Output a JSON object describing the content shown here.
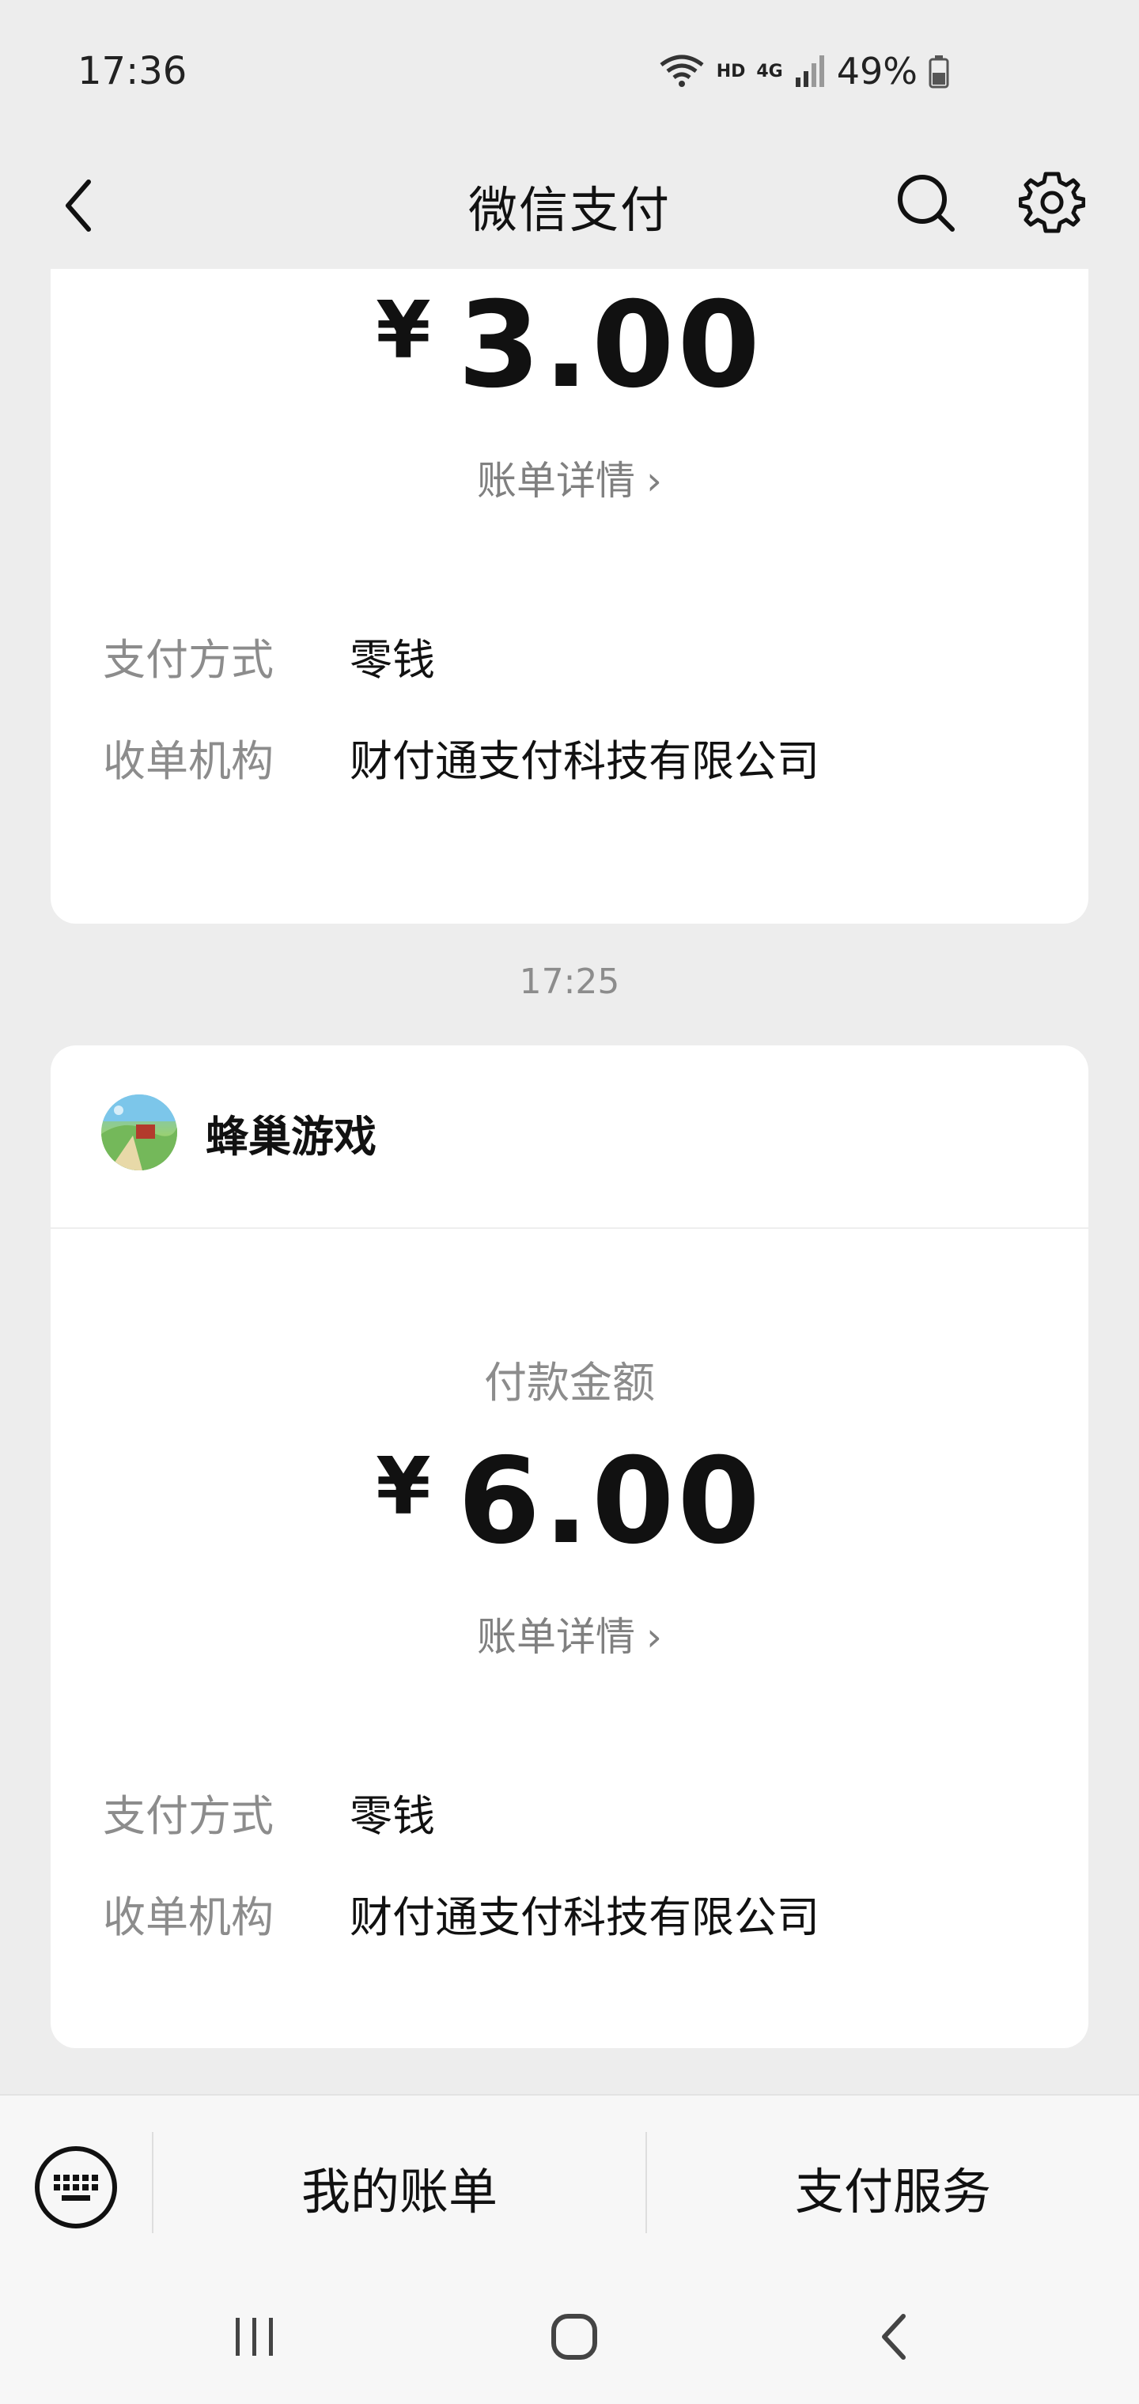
{
  "status_bar": {
    "time": "17:36",
    "network_hd": "HD",
    "network_4g": "4G",
    "battery": "49%"
  },
  "header": {
    "title": "微信支付",
    "icons": [
      "back-icon",
      "search-icon",
      "gear-icon"
    ]
  },
  "transactions": [
    {
      "amount": "3.00",
      "currency_symbol": "¥",
      "bill_details_label": "账单详情",
      "payment_method_label": "支付方式",
      "payment_method": "零钱",
      "acquirer_label": "收单机构",
      "acquirer": "财付通支付科技有限公司"
    },
    {
      "time": "17:25",
      "merchant": "蜂巢游戏",
      "payment_amount_label": "付款金额",
      "amount": "6.00",
      "currency_symbol": "¥",
      "bill_details_label": "账单详情",
      "payment_method_label": "支付方式",
      "payment_method": "零钱",
      "acquirer_label": "收单机构",
      "acquirer": "财付通支付科技有限公司"
    }
  ],
  "bottom_bar": {
    "my_bills": "我的账单",
    "payment_services": "支付服务",
    "icons": [
      "keyboard-icon"
    ]
  },
  "colors": {
    "background": "#ededed",
    "card": "#ffffff",
    "secondary_text": "#8c8c8c"
  }
}
